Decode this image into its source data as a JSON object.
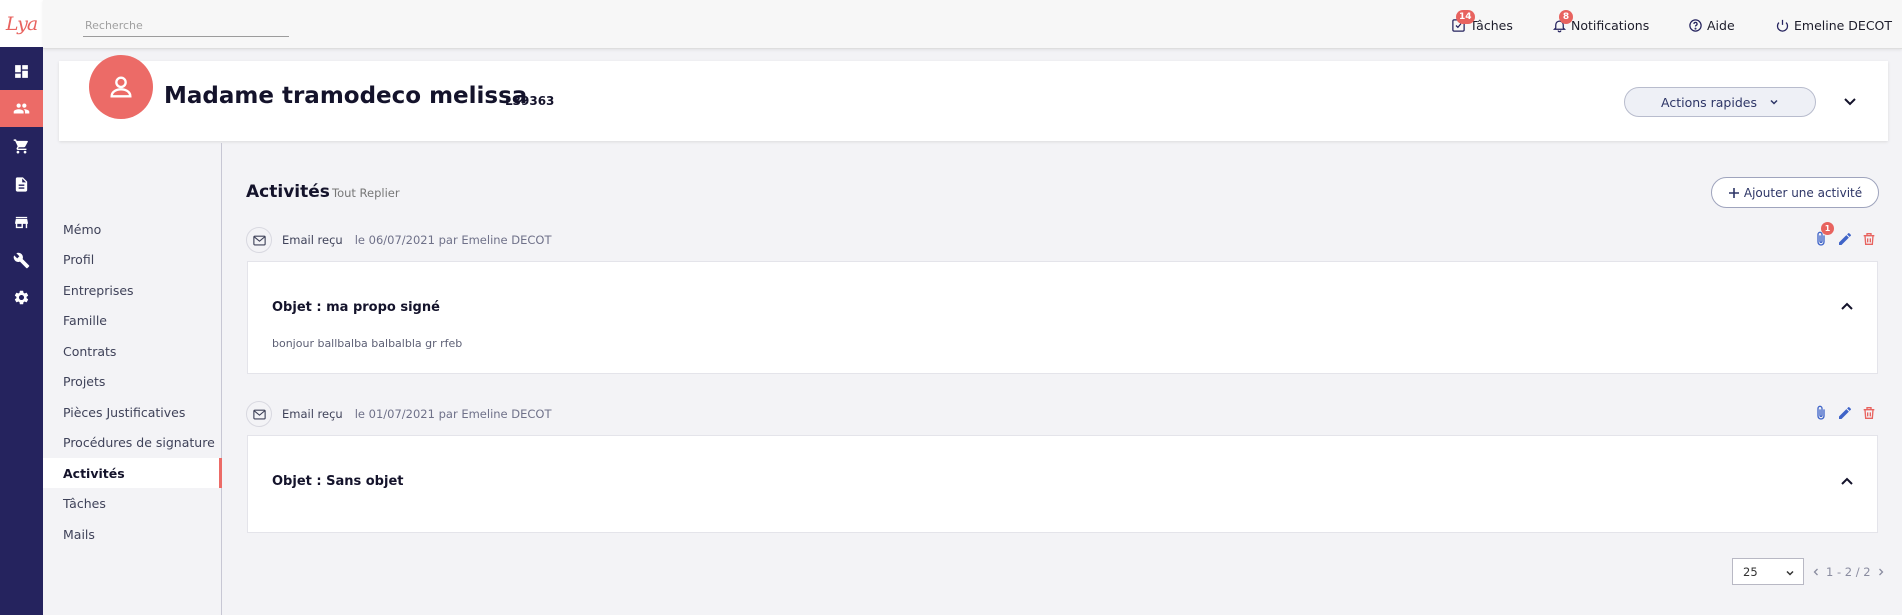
{
  "brand": {
    "logo_text": "Lya",
    "accent": "#ec6b67",
    "rail_color": "#25235e"
  },
  "rail": {
    "items": [
      {
        "icon": "dashboard-icon",
        "active": false
      },
      {
        "icon": "people-icon",
        "active": true
      },
      {
        "icon": "cart-icon",
        "active": false
      },
      {
        "icon": "document-icon",
        "active": false
      },
      {
        "icon": "store-icon",
        "active": false
      },
      {
        "icon": "tools-icon",
        "active": false
      },
      {
        "icon": "gear-icon",
        "active": false
      }
    ]
  },
  "topbar": {
    "search_placeholder": "Recherche",
    "tasks": {
      "label": "Tâches",
      "badge": "14",
      "icon": "task-check-icon"
    },
    "notifications": {
      "label": "Notifications",
      "badge": "8",
      "icon": "bell-icon"
    },
    "help": {
      "label": "Aide",
      "icon": "help-icon"
    },
    "user": {
      "label": "Emeline DECOT",
      "icon": "power-icon"
    }
  },
  "contact": {
    "name": "Madame tramodeco melissa",
    "ref": "L39363",
    "avatar_icon": "user-icon",
    "quick_actions_label": "Actions rapides"
  },
  "submenu": {
    "items": [
      {
        "label": "Mémo",
        "active": false
      },
      {
        "label": "Profil",
        "active": false
      },
      {
        "label": "Entreprises",
        "active": false
      },
      {
        "label": "Famille",
        "active": false
      },
      {
        "label": "Contrats",
        "active": false
      },
      {
        "label": "Projets",
        "active": false
      },
      {
        "label": "Pièces Justificatives",
        "active": false
      },
      {
        "label": "Procédures de signature",
        "active": false
      },
      {
        "label": "Activités",
        "active": true
      },
      {
        "label": "Tâches",
        "active": false
      },
      {
        "label": "Mails",
        "active": false
      }
    ]
  },
  "activities": {
    "title": "Activités",
    "collapse_all": "Tout Replier",
    "add_label": "Ajouter une activité",
    "items": [
      {
        "type": "Email reçu",
        "date": "le 06/07/2021 par Emeline DECOT",
        "attachment_badge": "1",
        "subject": "Objet : ma propo signé",
        "body": "bonjour ballbalba balbalbla gr rfeb"
      },
      {
        "type": "Email reçu",
        "date": "le 01/07/2021 par Emeline DECOT",
        "attachment_badge": "",
        "subject": "Objet : Sans objet",
        "body": ""
      }
    ]
  },
  "pagination": {
    "page_size": "25",
    "range": "1 - 2 / 2"
  }
}
